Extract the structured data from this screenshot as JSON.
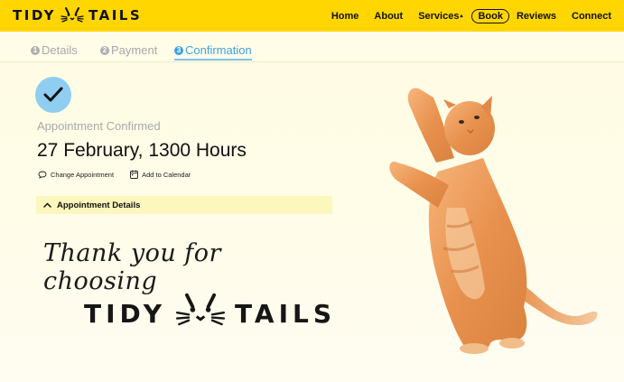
{
  "brand": {
    "logo_left": "TIDY",
    "logo_right": "TAILS",
    "logo_icon": "cat-face-icon"
  },
  "nav": {
    "items": [
      {
        "label": "Home"
      },
      {
        "label": "About"
      },
      {
        "label": "Services",
        "caret": "▴"
      },
      {
        "label": "Book"
      },
      {
        "label": "Reviews"
      },
      {
        "label": "Connect"
      }
    ]
  },
  "steps": [
    {
      "number": "1",
      "label": "Details",
      "state": "done"
    },
    {
      "number": "2",
      "label": "Payment",
      "state": "done"
    },
    {
      "number": "3",
      "label": "Confirmation",
      "state": "active"
    }
  ],
  "confirmation": {
    "status_label": "Appointment Confirmed",
    "datetime": "27 February, 1300 Hours",
    "change_label": "Change Appointment",
    "calendar_label": "Add to Calendar",
    "details_label": "Appointment Details"
  },
  "thank_you": {
    "message": "Thank you for choosing",
    "logo_left": "TIDY",
    "logo_right": "TAILS"
  },
  "colors": {
    "header_bg": "#ffd600",
    "accent_blue": "#3ea3e6",
    "check_bg": "#8fcdf1",
    "details_bg": "#fcf7bd"
  }
}
